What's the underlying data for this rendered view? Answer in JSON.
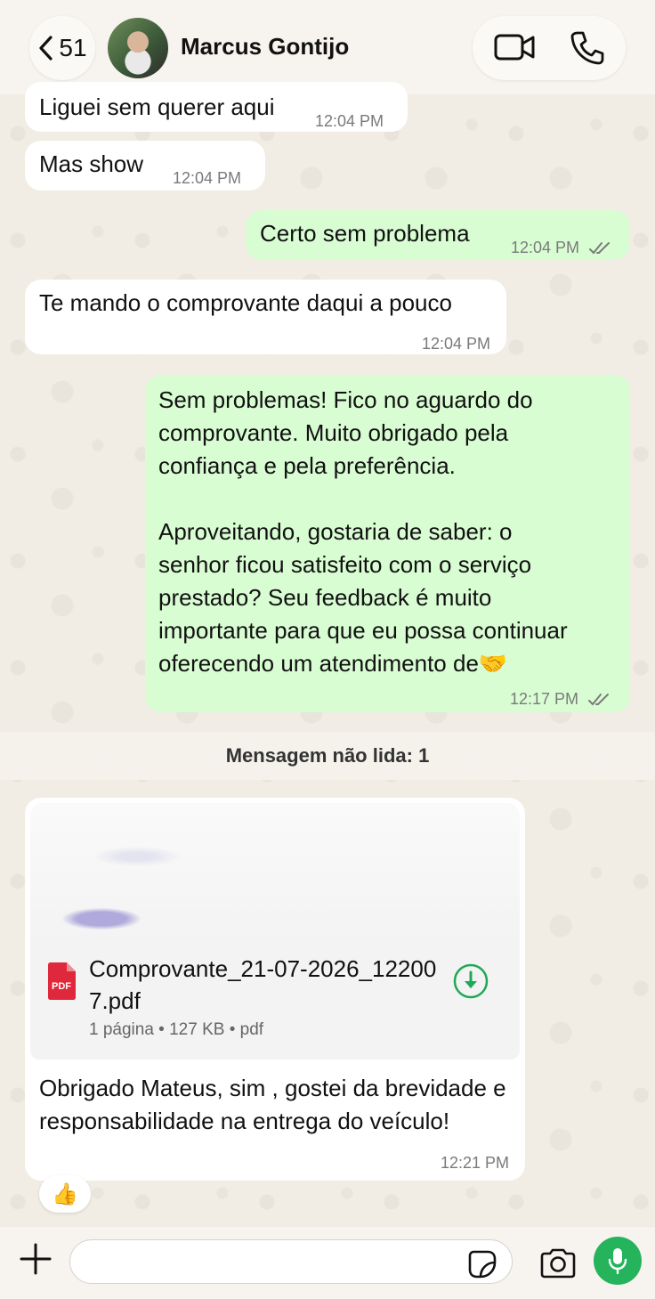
{
  "header": {
    "back_count": "51",
    "contact_name": "Marcus Gontijo"
  },
  "messages": [
    {
      "dir": "in",
      "text": "Liguei sem querer aqui",
      "time": "12:04 PM"
    },
    {
      "dir": "in",
      "text": "Mas show",
      "time": "12:04 PM"
    },
    {
      "dir": "out",
      "text": "Certo sem problema",
      "time": "12:04 PM"
    },
    {
      "dir": "in",
      "text": "Te mando o comprovante daqui a pouco",
      "time": "12:04 PM"
    },
    {
      "dir": "out",
      "text_lines": [
        "Sem problemas! Fico no aguardo do",
        "comprovante. Muito obrigado pela",
        "confiança e pela preferência.",
        "",
        "Aproveitando, gostaria de saber: o",
        "senhor ficou satisfeito com o serviço",
        "prestado? Seu feedback é muito",
        "importante para que eu possa continuar",
        "oferecendo um atendimento de🤝"
      ],
      "time": "12:17 PM"
    }
  ],
  "unread_banner": "Mensagem não lida: 1",
  "document": {
    "file_name": "Comprovante_21-07-2026_122007.pdf",
    "file_icon_label": "PDF",
    "meta": "1 página • 127 KB • pdf",
    "caption": "Obrigado Mateus, sim , gostei da brevidade e responsabilidade na entrega do veículo!",
    "time": "12:21 PM",
    "reaction": "👍"
  },
  "composer": {
    "placeholder": ""
  },
  "icons": [
    "back-chevron-icon",
    "video-call-icon",
    "phone-call-icon",
    "double-check-icon",
    "pdf-icon",
    "download-icon",
    "plus-icon",
    "sticker-icon",
    "camera-icon",
    "microphone-icon"
  ],
  "colors": {
    "outgoing_bubble": "#d9fdd3",
    "incoming_bubble": "#ffffff",
    "accent_green": "#25b35b",
    "read_tick": "#7a7a7a"
  }
}
